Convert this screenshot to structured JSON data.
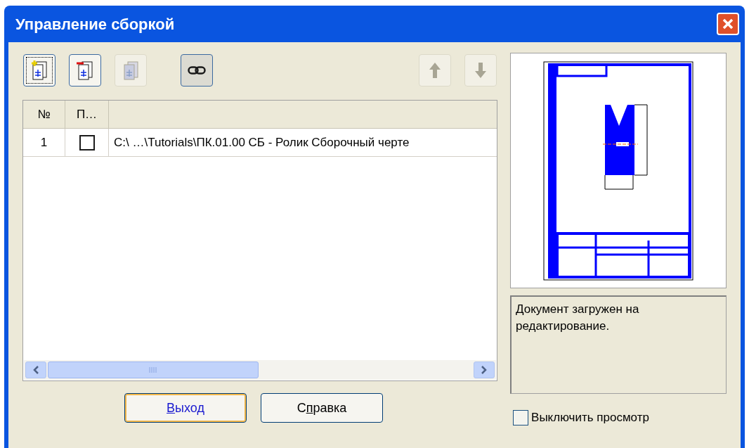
{
  "window": {
    "title": "Управление сборкой"
  },
  "toolbar": [
    {
      "kind": "add",
      "disabled": false,
      "pressed": false,
      "focused": true
    },
    {
      "kind": "remove",
      "disabled": false,
      "pressed": false,
      "focused": false
    },
    {
      "kind": "replace",
      "disabled": true,
      "pressed": false,
      "focused": false
    },
    {
      "kind": "link",
      "disabled": false,
      "pressed": true,
      "focused": false
    },
    {
      "kind": "up",
      "disabled": true,
      "pressed": false,
      "focused": false
    },
    {
      "kind": "down",
      "disabled": true,
      "pressed": false,
      "focused": false
    }
  ],
  "table": {
    "columns": [
      "№",
      "П…"
    ],
    "rows": [
      {
        "number": "1",
        "checked": false,
        "path": "C:\\ …\\Tutorials\\ПК.01.00 СБ - Ролик Сборочный черте"
      }
    ]
  },
  "description": "Документ загружен на редактирование.",
  "buttons": [
    {
      "access_key": "В",
      "label_end": "ыход",
      "default": true
    },
    {
      "label_start": "С",
      "access_key": "п",
      "label_end": "равка",
      "default": false
    }
  ],
  "disable_preview": {
    "label": "Выключить просмотр",
    "checked": false
  }
}
